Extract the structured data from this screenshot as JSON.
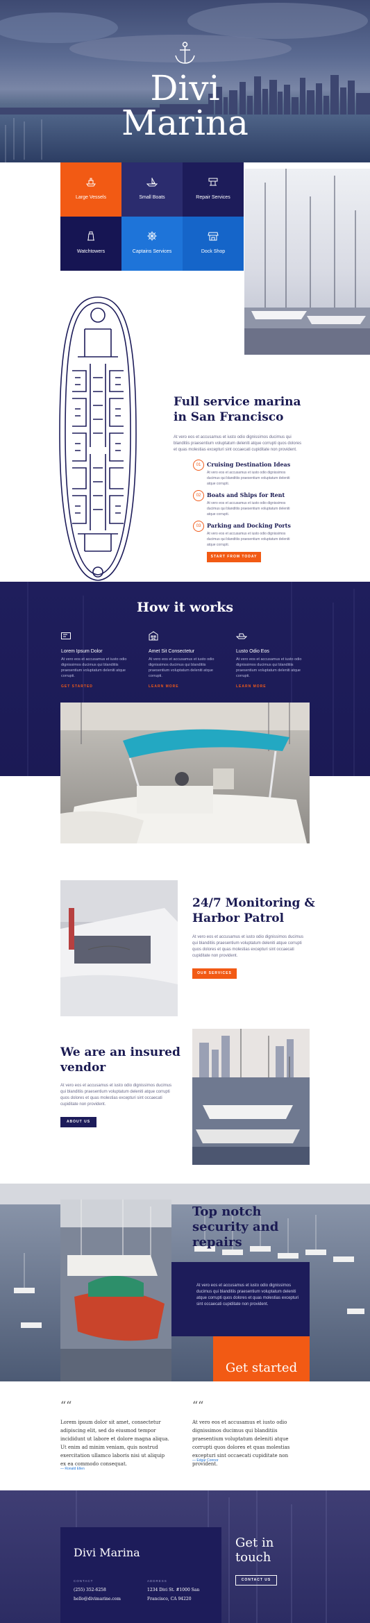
{
  "hero": {
    "title_line1": "Divi",
    "title_line2": "Marina"
  },
  "services": [
    {
      "label": "Large Vessels",
      "icon": "ship-icon",
      "color": "#f25a14"
    },
    {
      "label": "Small Boats",
      "icon": "boat-icon",
      "color": "#2b2c6e"
    },
    {
      "label": "Repair Services",
      "icon": "tools-icon",
      "color": "#1d1c5a"
    },
    {
      "label": "Watchtowers",
      "icon": "lighthouse-icon",
      "color": "#161553"
    },
    {
      "label": "Captains Services",
      "icon": "wheel-icon",
      "color": "#1e74d9"
    },
    {
      "label": "Dock Shop",
      "icon": "shop-icon",
      "color": "#1565c9"
    }
  ],
  "marina": {
    "title_line1": "Full service marina",
    "title_line2": "in San Francisco",
    "intro": "At vero eos et accusamus et iusto odio dignissimos ducimus qui blanditiis praesentium voluptatum deleniti atque corrupti quos dolores et quas molestias excepturi sint occaecati cupiditate non provident.",
    "features": [
      {
        "num": "01",
        "title": "Cruising Destination Ideas",
        "text": "At vero eos et accusamus et iusto odio dignissimos ducimus qui blanditiis praesentium voluptatum deleniti atque corrupti."
      },
      {
        "num": "02",
        "title": "Boats and Ships for Rent",
        "text": "At vero eos et accusamus et iusto odio dignissimos ducimus qui blanditiis praesentium voluptatum deleniti atque corrupti."
      },
      {
        "num": "03",
        "title": "Parking and Docking Ports",
        "text": "At vero eos et accusamus et iusto odio dignissimos ducimus qui blanditiis praesentium voluptatum deleniti atque corrupti."
      }
    ],
    "cta": "START FROM TODAY"
  },
  "how": {
    "title": "How it works",
    "columns": [
      {
        "title": "Lorem Ipsum Dolor",
        "icon": "ticket-icon",
        "text": "At vero eos et accusamus et iusto odio dignissimos ducimus qui blanditiis praesentium voluptatum deleniti atque corrupti.",
        "link": "GET STARTED"
      },
      {
        "title": "Amet Sit Consectetur",
        "icon": "building-icon",
        "text": "At vero eos et accusamus et iusto odio dignissimos ducimus qui blanditiis praesentium voluptatum deleniti atque corrupti.",
        "link": "LEARN MORE"
      },
      {
        "title": "Lusto Odio Eos",
        "icon": "boat-icon",
        "text": "At vero eos et accusamus et iusto odio dignissimos ducimus qui blanditiis praesentium voluptatum deleniti atque corrupti.",
        "link": "LEARN MORE"
      }
    ]
  },
  "monitoring": {
    "title_line1": "24/7 Monitoring &",
    "title_line2": "Harbor Patrol",
    "text": "At vero eos et accusamus et iusto odio dignissimos ducimus qui blanditiis praesentium voluptatum deleniti atque corrupti quos dolores et quas molestias excepturi sint occaecati cupiditate non provident.",
    "cta": "OUR SERVICES"
  },
  "insured": {
    "title_line1": "We are an insured",
    "title_line2": "vendor",
    "text": "At vero eos et accusamus et iusto odio dignissimos ducimus qui blanditiis praesentium voluptatum deleniti atque corrupti quos dolores et quas molestias excepturi sint occaecati cupiditate non provident.",
    "cta": "ABOUT US"
  },
  "repairs": {
    "title_line1": "Top notch",
    "title_line2": "security and",
    "title_line3": "repairs",
    "text": "At vero eos et accusamus et iusto odio dignissimos ducimus qui blanditiis praesentium voluptatum deleniti atque corrupti quos dolores et quas molestias excepturi sint occaecati cupiditate non provident.",
    "cta": "Get started"
  },
  "testimonials": [
    {
      "text": "Lorem ipsum dolor sit amet, consectetur adipiscing elit, sed do eiusmod tempor incididunt ut labore et dolore magna aliqua. Ut enim ad minim veniam, quis nostrud exercitation ullamco laboris nisi ut aliquip ex ea commodo consequat.",
      "author": "— Ronald Ellen"
    },
    {
      "text": "At vero eos et accusamus et iusto odio dignissimos ducimus qui blanditiis praesentium voluptatum deleniti atque corrupti quos dolores et quas molestias excepturi sint occaecati cupiditate non provident.",
      "author": "— Edgar Connor"
    }
  ],
  "footer": {
    "brand": "Divi Marina",
    "contact_label": "CONTACT",
    "phone": "(255) 352-6258",
    "email": "hello@divimarine.com",
    "address_label": "ADDRESS",
    "address_line1": "1234 Divi St. #1000 San",
    "address_line2": "Francisco, CA 94220",
    "touch_line1": "Get in",
    "touch_line2": "touch",
    "cta": "CONTACT US"
  }
}
